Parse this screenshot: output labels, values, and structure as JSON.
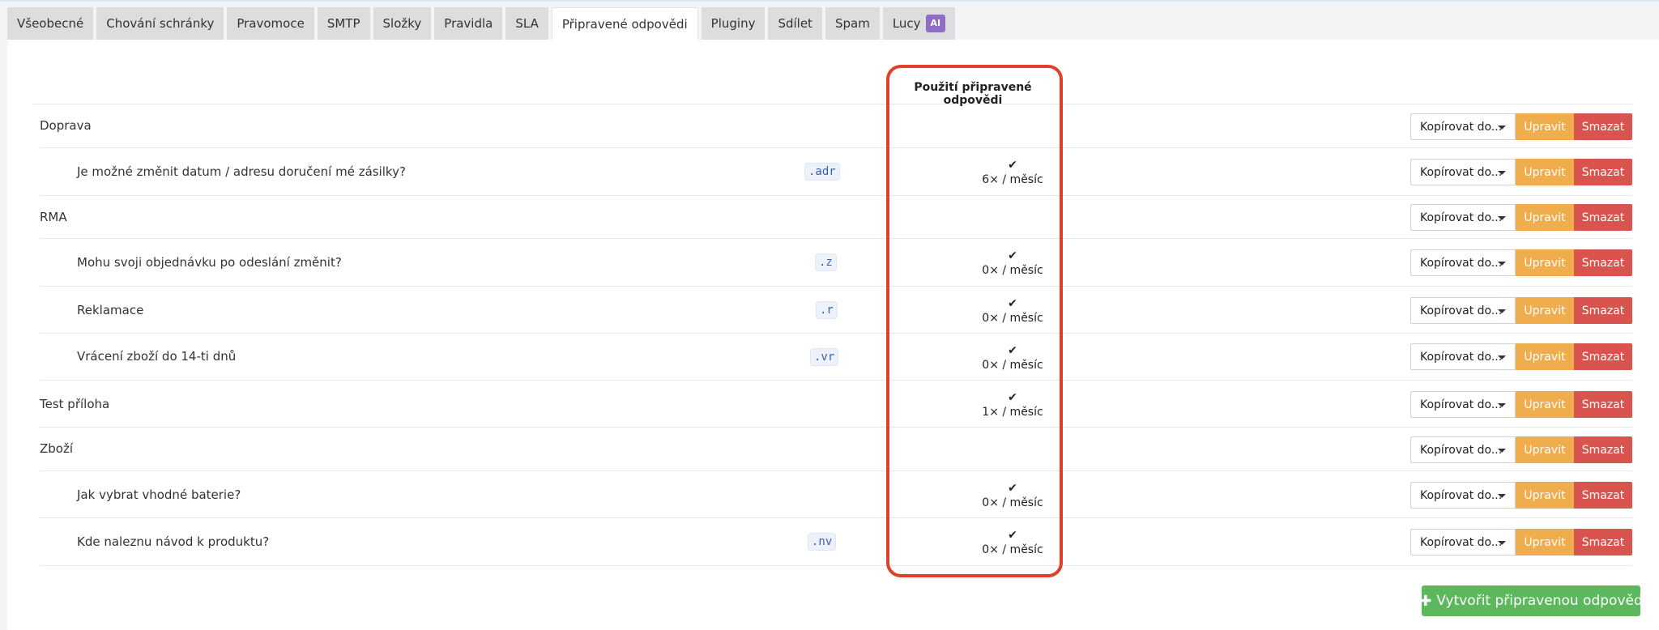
{
  "tabs": [
    {
      "label": "Všeobecné",
      "active": false
    },
    {
      "label": "Chování schránky",
      "active": false
    },
    {
      "label": "Pravomoce",
      "active": false
    },
    {
      "label": "SMTP",
      "active": false
    },
    {
      "label": "Složky",
      "active": false
    },
    {
      "label": "Pravidla",
      "active": false
    },
    {
      "label": "SLA",
      "active": false
    },
    {
      "label": "Připravené odpovědi",
      "active": true
    },
    {
      "label": "Pluginy",
      "active": false
    },
    {
      "label": "Sdílet",
      "active": false
    },
    {
      "label": "Spam",
      "active": false
    },
    {
      "label": "Lucy",
      "active": false,
      "badge": "AI"
    }
  ],
  "table": {
    "usage_header": "Použití připravené odpovědi",
    "rows": [
      {
        "title": "Doprava",
        "indent": false,
        "shortcut": "",
        "check": "",
        "usage": ""
      },
      {
        "title": "Je možné změnit datum / adresu doručení mé zásilky?",
        "indent": true,
        "shortcut": ".adr",
        "check": "✔",
        "usage": "6× / měsíc"
      },
      {
        "title": "RMA",
        "indent": false,
        "shortcut": "",
        "check": "",
        "usage": ""
      },
      {
        "title": "Mohu svoji objednávku po odeslání změnit?",
        "indent": true,
        "shortcut": ".z",
        "check": "✔",
        "usage": "0× / měsíc"
      },
      {
        "title": "Reklamace",
        "indent": true,
        "shortcut": ".r",
        "check": "✔",
        "usage": "0× / měsíc"
      },
      {
        "title": "Vrácení zboží do 14-ti dnů",
        "indent": true,
        "shortcut": ".vr",
        "check": "✔",
        "usage": "0× / měsíc"
      },
      {
        "title": "Test příloha",
        "indent": false,
        "shortcut": "",
        "check": "✔",
        "usage": "1× / měsíc"
      },
      {
        "title": "Zboží",
        "indent": false,
        "shortcut": "",
        "check": "",
        "usage": ""
      },
      {
        "title": "Jak vybrat vhodné baterie?",
        "indent": true,
        "shortcut": "",
        "check": "✔",
        "usage": "0× / měsíc"
      },
      {
        "title": "Kde naleznu návod k produktu?",
        "indent": true,
        "shortcut": ".nv",
        "check": "✔",
        "usage": "0× / měsíc"
      }
    ]
  },
  "actions": {
    "copy_label": "Kopírovat do...",
    "edit_label": "Upravit",
    "delete_label": "Smazat"
  },
  "create_button": {
    "label": "Vytvořit připravenou odpověď"
  },
  "colors": {
    "edit": "#f0ad4e",
    "delete": "#d9534f",
    "create": "#5cb85c",
    "highlight": "#e0402b",
    "ai_badge": "#8e6cc7"
  }
}
